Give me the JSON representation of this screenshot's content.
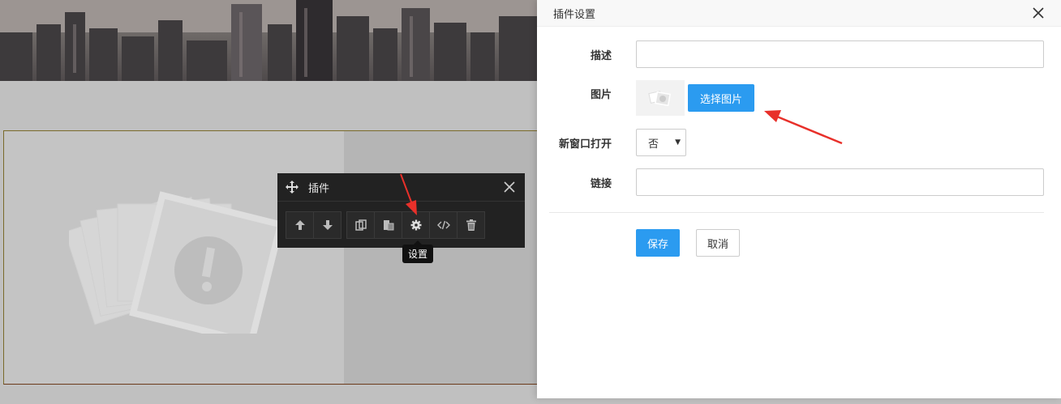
{
  "toolbar": {
    "title": "插件",
    "tooltip": "设置",
    "buttons": [
      "arrow-up-icon",
      "arrow-down-icon",
      "copy-icon",
      "paste-icon",
      "gear-icon",
      "code-icon",
      "trash-icon"
    ]
  },
  "dialog": {
    "title": "插件设置",
    "fields": {
      "description_label": "描述",
      "description_value": "",
      "image_label": "图片",
      "choose_image_label": "选择图片",
      "new_window_label": "新窗口打开",
      "new_window_value": "否",
      "link_label": "链接",
      "link_value": ""
    },
    "save_label": "保存",
    "cancel_label": "取消"
  },
  "colors": {
    "primary": "#2b9bf0",
    "annotation_arrow": "#e8302a",
    "toolbar_bg": "#222222"
  }
}
